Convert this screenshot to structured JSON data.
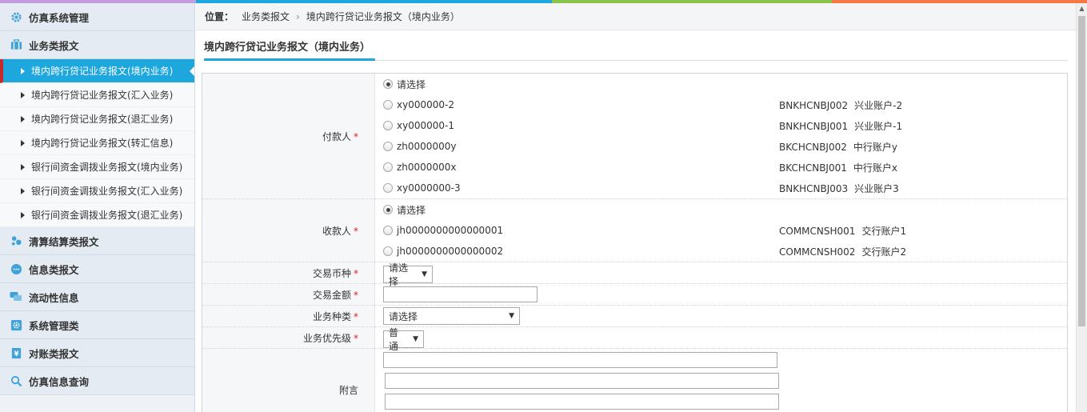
{
  "colors": {
    "strip": [
      "#c39bdf",
      "#1da7dd",
      "#8bc34a",
      "#f47a45"
    ],
    "accent": "#1da7dd",
    "active_marker": "#c62a2a"
  },
  "sidebar": {
    "groups": [
      {
        "label": "仿真系统管理",
        "icon": "gear-icon"
      },
      {
        "label": "业务类报文",
        "icon": "briefcase-icon",
        "items": [
          "境内跨行贷记业务报文(境内业务)",
          "境内跨行贷记业务报文(汇入业务)",
          "境内跨行贷记业务报文(退汇业务)",
          "境内跨行贷记业务报文(转汇信息)",
          "银行间资金调拨业务报文(境内业务)",
          "银行间资金调拨业务报文(汇入业务)",
          "银行间资金调拨业务报文(退汇业务)"
        ]
      },
      {
        "label": "清算结算类报文",
        "icon": "cluster-icon"
      },
      {
        "label": "信息类报文",
        "icon": "chat-icon"
      },
      {
        "label": "流动性信息",
        "icon": "comments-icon"
      },
      {
        "label": "系统管理类",
        "icon": "settings-icon"
      },
      {
        "label": "对账类报文",
        "icon": "book-icon"
      },
      {
        "label": "仿真信息查询",
        "icon": "search-icon"
      }
    ]
  },
  "breadcrumb": {
    "label": "位置：",
    "level1": "业务类报文",
    "level2": "境内跨行贷记业务报文（境内业务）"
  },
  "page_title": "境内跨行贷记业务报文（境内业务）",
  "form": {
    "payer": {
      "label": "付款人",
      "placeholder_option": "请选择",
      "options": [
        {
          "acc": "xy000000-2",
          "code": "BNKHCNBJ002",
          "name": "兴业账户-2"
        },
        {
          "acc": "xy000000-1",
          "code": "BNKHCNBJ001",
          "name": "兴业账户-1"
        },
        {
          "acc": "zh0000000y",
          "code": "BKCHCNBJ002",
          "name": "中行账户y"
        },
        {
          "acc": "zh0000000x",
          "code": "BKCHCNBJ001",
          "name": "中行账户x"
        },
        {
          "acc": "xy0000000-3",
          "code": "BNKHCNBJ003",
          "name": "兴业账户3"
        }
      ]
    },
    "payee": {
      "label": "收款人",
      "placeholder_option": "请选择",
      "options": [
        {
          "acc": "jh0000000000000001",
          "code": "COMMCNSH001",
          "name": "交行账户1"
        },
        {
          "acc": "jh0000000000000002",
          "code": "COMMCNSH002",
          "name": "交行账户2"
        }
      ]
    },
    "currency": {
      "label": "交易币种",
      "value": "请选择"
    },
    "amount": {
      "label": "交易金额",
      "value": ""
    },
    "biz_type": {
      "label": "业务种类",
      "value": "请选择"
    },
    "priority": {
      "label": "业务优先级",
      "value": "普通"
    },
    "remark": {
      "label": "附言"
    },
    "required_mark": "*"
  }
}
